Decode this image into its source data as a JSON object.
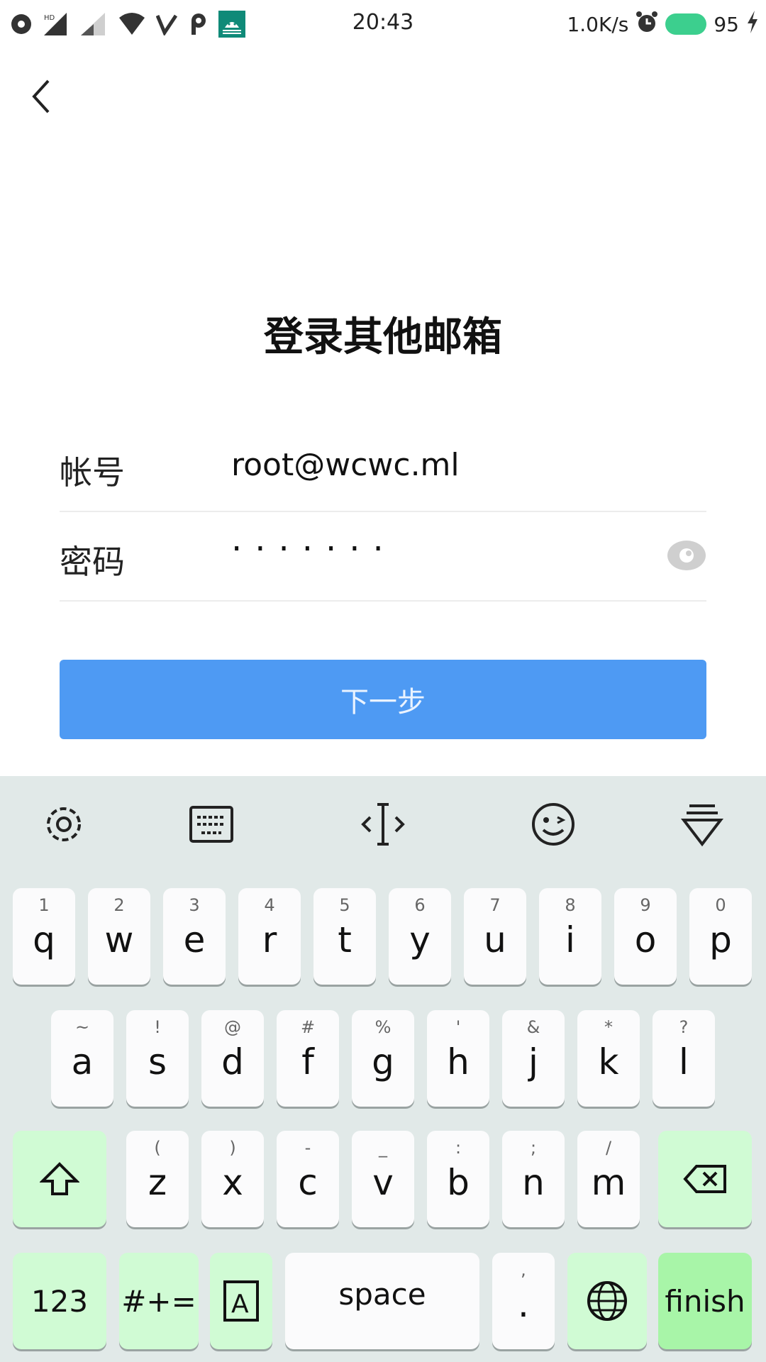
{
  "status_bar": {
    "time": "20:43",
    "net_speed": "1.0K/s",
    "battery": "95"
  },
  "page": {
    "title": "登录其他邮箱"
  },
  "form": {
    "account_label": "帐号",
    "account_value": "root@wcwc.ml",
    "password_label": "密码",
    "password_value": "·······"
  },
  "next_button": "下一步",
  "keyboard": {
    "row1": [
      {
        "hint": "1",
        "key": "q"
      },
      {
        "hint": "2",
        "key": "w"
      },
      {
        "hint": "3",
        "key": "e"
      },
      {
        "hint": "4",
        "key": "r"
      },
      {
        "hint": "5",
        "key": "t"
      },
      {
        "hint": "6",
        "key": "y"
      },
      {
        "hint": "7",
        "key": "u"
      },
      {
        "hint": "8",
        "key": "i"
      },
      {
        "hint": "9",
        "key": "o"
      },
      {
        "hint": "0",
        "key": "p"
      }
    ],
    "row2": [
      {
        "hint": "~",
        "key": "a"
      },
      {
        "hint": "!",
        "key": "s"
      },
      {
        "hint": "@",
        "key": "d"
      },
      {
        "hint": "#",
        "key": "f"
      },
      {
        "hint": "%",
        "key": "g"
      },
      {
        "hint": "'",
        "key": "h"
      },
      {
        "hint": "&",
        "key": "j"
      },
      {
        "hint": "*",
        "key": "k"
      },
      {
        "hint": "?",
        "key": "l"
      }
    ],
    "row3": [
      {
        "hint": "(",
        "key": "z"
      },
      {
        "hint": ")",
        "key": "x"
      },
      {
        "hint": "-",
        "key": "c"
      },
      {
        "hint": "_",
        "key": "v"
      },
      {
        "hint": ":",
        "key": "b"
      },
      {
        "hint": ";",
        "key": "n"
      },
      {
        "hint": "/",
        "key": "m"
      }
    ],
    "numbers_label": "123",
    "symbols_label": "#+=",
    "space_label": "space",
    "period_hint": ",",
    "period_label": ".",
    "finish_label": "finish"
  }
}
